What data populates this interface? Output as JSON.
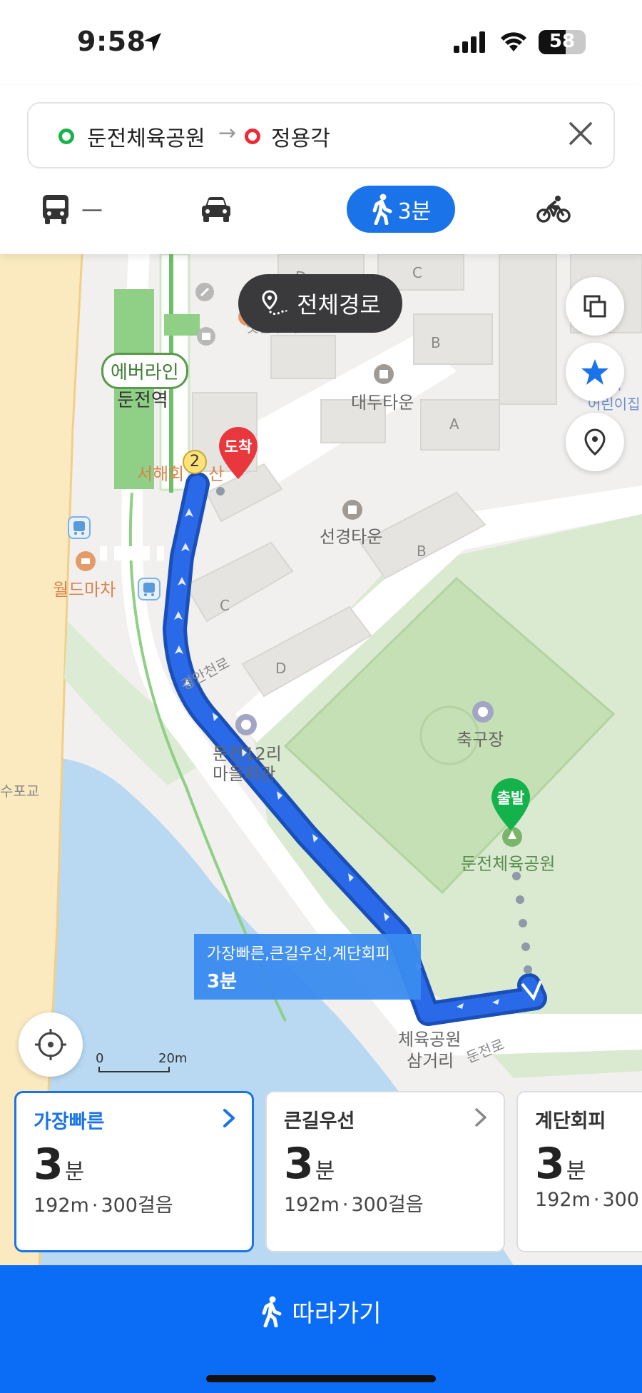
{
  "status": {
    "time": "9:58",
    "battery": "58",
    "battery_level": 0.58
  },
  "search": {
    "origin": "둔전체육공원",
    "destination": "정용각",
    "arrow": "→"
  },
  "modes": {
    "bus_label": "—",
    "walk_label": "3분",
    "icons": [
      "bus-icon",
      "car-icon",
      "walk-icon",
      "bicycle-icon"
    ],
    "active": "walk",
    "active_color": "#1a73e8"
  },
  "map": {
    "overview_button": "전체경로",
    "labels": {
      "everline": "에버라인",
      "station": "둔전역",
      "daedu_town": "대두타운",
      "seongyeong_town": "선경타운",
      "seohae": "서해회",
      "seohae_rest": "산",
      "world_macha": "월드마차",
      "gyeongancheon_ro": "경안천로",
      "village_hall_1": "둔전12리",
      "village_hall_2": "마을회관",
      "soccer": "축구장",
      "park": "둔전체육공원",
      "sports_park_junction_1": "체육공원",
      "sports_park_junction_2": "삼거리",
      "dunjeon_ro": "둔전로",
      "supogyo": "수포교",
      "jutaek": "옛날주택",
      "kids_1": "소화",
      "kids_2": "어린이집",
      "bldg_a": "A",
      "bldg_b1": "B",
      "bldg_b2": "B",
      "bldg_c1": "C",
      "bldg_c2": "C",
      "bldg_d1": "D",
      "bldg_d2": "D",
      "exit_no": "2"
    },
    "arrival_pin": "도착",
    "departure_pin": "출발",
    "tooltip": {
      "options": "가장빠른,큰길우선,계단회피",
      "time": "3분"
    },
    "scale": {
      "zero": "0",
      "max": "20m"
    },
    "route_color": "#1f5fd6",
    "right_buttons": [
      "layers-icon",
      "star-icon",
      "location-pin-icon"
    ]
  },
  "routes": [
    {
      "name": "가장빠른",
      "minutes": "3",
      "unit": "분",
      "distance": "192m",
      "sep": "·",
      "steps": "300걸음",
      "active": true
    },
    {
      "name": "큰길우선",
      "minutes": "3",
      "unit": "분",
      "distance": "192m",
      "sep": "·",
      "steps": "300걸음",
      "active": false
    },
    {
      "name": "계단회피",
      "minutes": "3",
      "unit": "분",
      "distance": "192m",
      "sep": "·",
      "steps": "300",
      "active": false
    }
  ],
  "follow_button": "따라가기"
}
